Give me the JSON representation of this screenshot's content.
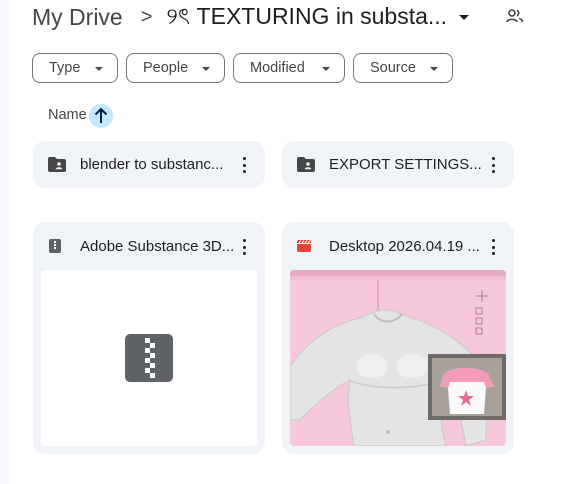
{
  "breadcrumb": {
    "root": "My Drive",
    "separator": ">",
    "current": "୨ৎ TEXTURING in substa..."
  },
  "filters": [
    {
      "label": "Type"
    },
    {
      "label": "People"
    },
    {
      "label": "Modified"
    },
    {
      "label": "Source"
    }
  ],
  "sort": {
    "column": "Name",
    "direction": "ascending",
    "icon": "arrow-up-icon"
  },
  "folders": [
    {
      "name": "blender to substanc...",
      "icon": "shared-folder-icon"
    },
    {
      "name": "EXPORT SETTINGS...",
      "icon": "shared-folder-icon"
    }
  ],
  "files": [
    {
      "name": "Adobe Substance 3D...",
      "icon": "zip-archive-icon",
      "preview": "zip-archive-icon"
    },
    {
      "name": "Desktop 2026.04.19 ...",
      "icon": "video-icon",
      "preview": "video-thumbnail"
    }
  ],
  "colors": {
    "accent": "#c2e7ff",
    "card": "#f0f4f9",
    "video_icon": "#ea4335",
    "zip_icon": "#5f6368"
  }
}
